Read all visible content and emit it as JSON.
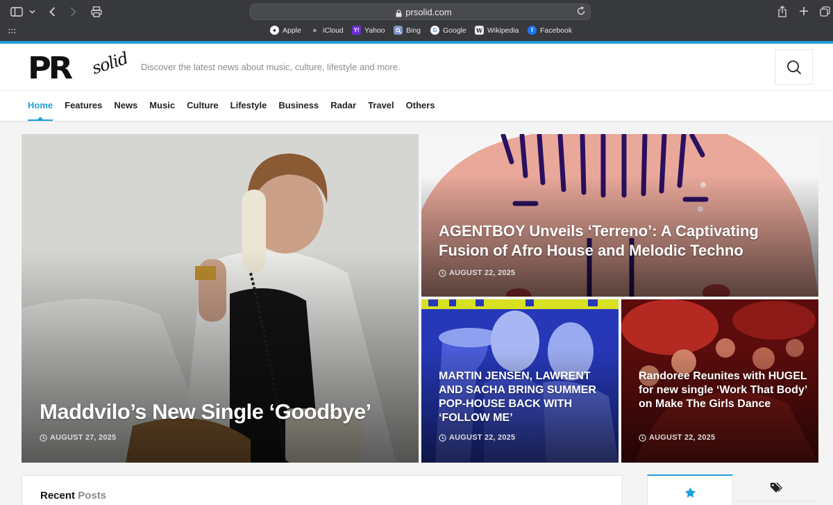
{
  "browser": {
    "url": "prsolid.com",
    "favorites": [
      {
        "label": "Apple",
        "icon": "apple-icon"
      },
      {
        "label": "iCloud",
        "icon": "icloud-icon"
      },
      {
        "label": "Yahoo",
        "icon": "yahoo-icon"
      },
      {
        "label": "Bing",
        "icon": "bing-icon"
      },
      {
        "label": "Google",
        "icon": "google-icon"
      },
      {
        "label": "Wikipedia",
        "icon": "wikipedia-icon"
      },
      {
        "label": "Facebook",
        "icon": "facebook-icon"
      }
    ]
  },
  "site": {
    "logo_main": "PR",
    "logo_script": "solid",
    "tagline": "Discover the latest news about music, culture, lifestyle and more.",
    "accent": "#1ea0d7"
  },
  "nav": {
    "items": [
      "Home",
      "Features",
      "News",
      "Music",
      "Culture",
      "Lifestyle",
      "Business",
      "Radar",
      "Travel",
      "Others"
    ],
    "active": "Home"
  },
  "featured": {
    "main": {
      "title": "Maddvilo’s New Single ‘Goodbye’",
      "date": "AUGUST 27, 2025"
    },
    "agent": {
      "title": "AGENTBOY Unveils ‘Terreno’: A Captivating Fusion of Afro House and Melodic Techno",
      "date": "AUGUST 22, 2025"
    },
    "martin": {
      "title": "MARTIN JENSEN, LAWRENT AND SACHA BRING SUMMER POP-HOUSE BACK WITH ‘FOLLOW ME’",
      "date": "AUGUST 22, 2025"
    },
    "rand": {
      "title": "Randoree Reunites with HUGEL for new single ‘Work That Body’ on Make The Girls Dance",
      "date": "AUGUST 22, 2025"
    }
  },
  "recent": {
    "title_strong": "Recent",
    "title_light": "Posts"
  },
  "sidebar": {
    "tabs": [
      "star-icon",
      "tags-icon"
    ]
  }
}
